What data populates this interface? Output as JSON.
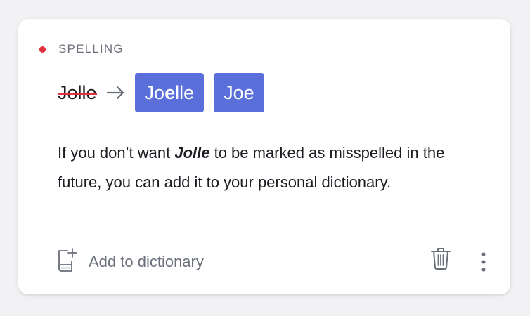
{
  "card": {
    "category": "SPELLING",
    "original_word": "Jolle",
    "suggestions": [
      {
        "before": "Jo",
        "bold": "e",
        "after": "lle"
      },
      {
        "before": "Joe",
        "bold": "",
        "after": ""
      }
    ],
    "description": {
      "before": "If you don’t want ",
      "word": "Jolle",
      "after": " to be marked as misspelled in the future, you can add it to your personal dictionary."
    },
    "add_to_dictionary_label": "Add to dictionary"
  },
  "icons": {
    "arrow": "arrow-right-icon",
    "dictionary": "dictionary-add-icon",
    "trash": "trash-icon",
    "more": "more-vertical-icon"
  },
  "colors": {
    "accent": "#5a6fd9",
    "error": "#e0313f",
    "muted": "#6b6f7b",
    "text": "#1b1d23"
  }
}
